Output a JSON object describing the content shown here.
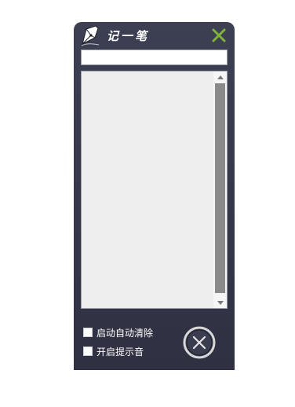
{
  "window": {
    "title": "记一笔",
    "logo_icon": "pen-nib-icon",
    "close_icon": "close-x-icon",
    "close_color": "#7fb33a",
    "background": "#35374a"
  },
  "note": {
    "title_input_value": "",
    "body_value": ""
  },
  "options": [
    {
      "label": "启动自动清除",
      "checked": false
    },
    {
      "label": "开启提示音",
      "checked": false
    }
  ],
  "actions": {
    "clear_icon": "circle-x-icon"
  }
}
